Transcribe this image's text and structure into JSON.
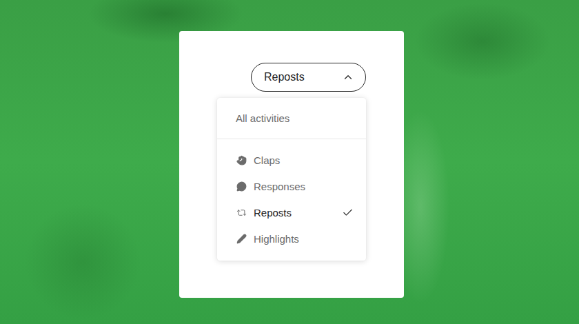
{
  "filter": {
    "label": "Reposts",
    "expanded": true
  },
  "menu": {
    "header": {
      "label": "All activities",
      "selected": false
    },
    "items": [
      {
        "label": "Claps",
        "selected": false
      },
      {
        "label": "Responses",
        "selected": false
      },
      {
        "label": "Reposts",
        "selected": true
      },
      {
        "label": "Highlights",
        "selected": false
      }
    ]
  }
}
